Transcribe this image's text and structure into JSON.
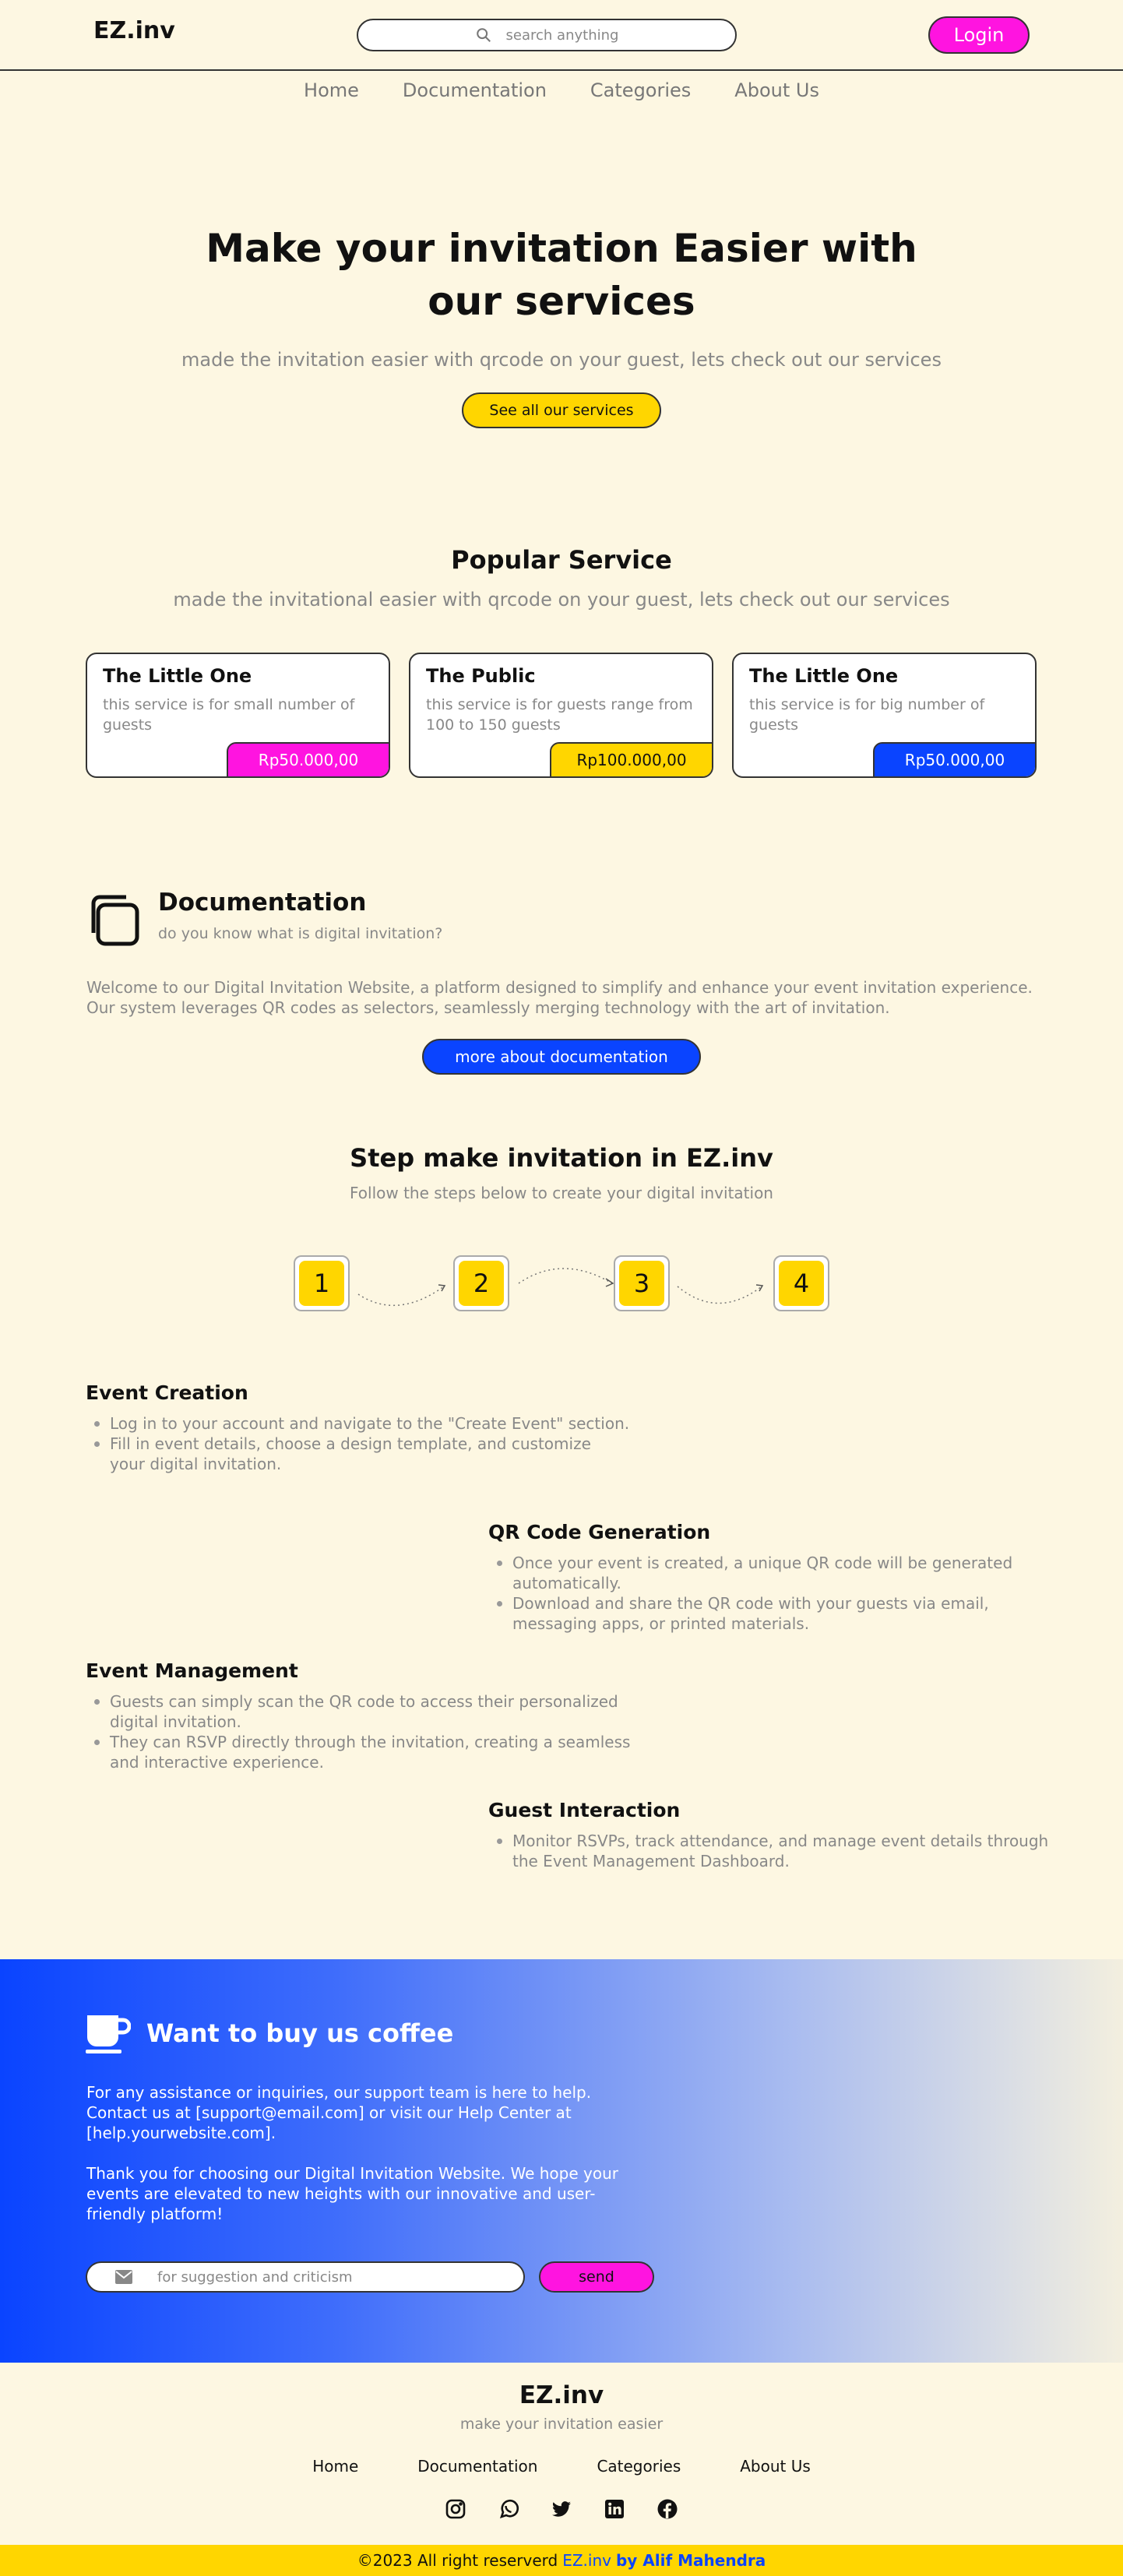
{
  "header": {
    "logo": "EZ.inv",
    "search_placeholder": "search anything",
    "login_label": "Login"
  },
  "nav": [
    "Home",
    "Documentation",
    "Categories",
    "About Us"
  ],
  "hero": {
    "title_line1": "Make your invitation Easier with",
    "title_line2": "our services",
    "subtitle": "made the invitation easier with qrcode on your guest, lets check out our services",
    "button": "See all our services"
  },
  "popular": {
    "title": "Popular Service",
    "subtitle": "made the invitational easier with qrcode on your guest, lets check out our services",
    "cards": [
      {
        "title": "The Little One",
        "desc": "this service is for small number of guests",
        "price": "Rp50.000,00",
        "color": "#ff14e0",
        "text_color": "#ffffff"
      },
      {
        "title": "The Public",
        "desc": "this service is for guests range from 100 to 150 guests",
        "price": "Rp100.000,00",
        "color": "#ffd600",
        "text_color": "#111111"
      },
      {
        "title": "The Little One",
        "desc": "this service is for big number of guests",
        "price": "Rp50.000,00",
        "color": "#0a44ff",
        "text_color": "#ffffff"
      }
    ]
  },
  "documentation": {
    "title": "Documentation",
    "subtitle": "do you know what is digital invitation?",
    "body": "Welcome to our Digital Invitation Website, a platform designed to simplify and enhance your event invitation experience. Our system leverages QR codes as selectors, seamlessly merging technology with the art of invitation.",
    "button": "more about documentation"
  },
  "steps": {
    "title": "Step make invitation in EZ.inv",
    "subtitle": "Follow the steps below to create your digital invitation",
    "numbers": [
      "1",
      "2",
      "3",
      "4"
    ],
    "blocks": [
      {
        "title": "Event Creation",
        "items": [
          "Log in to your account and navigate to the \"Create Event\" section.",
          "Fill in event details, choose a design template, and customize your digital invitation."
        ]
      },
      {
        "title": "QR Code Generation",
        "items": [
          "Once your event is created, a unique QR code will be generated automatically.",
          "Download and share the QR code with your guests via email, messaging apps, or printed materials."
        ]
      },
      {
        "title": "Event Management",
        "items": [
          "Guests can simply scan the QR code to access their personalized digital invitation.",
          "They can RSVP directly through the invitation, creating a seamless and interactive experience."
        ]
      },
      {
        "title": "Guest Interaction",
        "items": [
          "Monitor RSVPs, track attendance, and manage event details through the Event Management Dashboard."
        ]
      }
    ]
  },
  "coffee": {
    "title": "Want to buy us coffee",
    "p1": "For any assistance or inquiries, our support team is here to help. Contact us at [support@email.com] or visit our Help Center at [help.yourwebsite.com].",
    "p2": "Thank you for choosing our Digital Invitation Website. We hope your events are elevated to new heights with our innovative and user-friendly platform!",
    "input_placeholder": "for suggestion and criticism",
    "send_label": "send"
  },
  "footer": {
    "logo": "EZ.inv",
    "tagline": "make your invitation easier",
    "nav": [
      "Home",
      "Documentation",
      "Categories",
      "About Us"
    ],
    "socials": [
      "instagram-icon",
      "whatsapp-icon",
      "twitter-icon",
      "linkedin-icon",
      "facebook-icon"
    ],
    "copyright_text": "©2023 All right reserverd",
    "brand": "EZ.inv",
    "author": "by Alif Mahendra"
  }
}
